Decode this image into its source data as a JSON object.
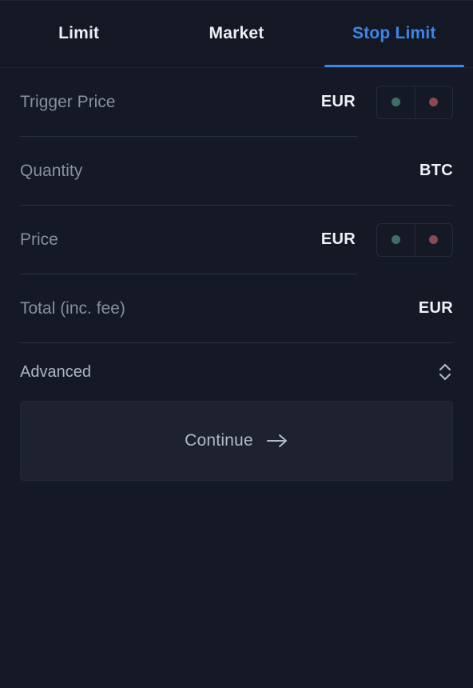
{
  "tabs": [
    {
      "label": "Limit",
      "active": false
    },
    {
      "label": "Market",
      "active": false
    },
    {
      "label": "Stop Limit",
      "active": true
    }
  ],
  "fields": {
    "trigger_price": {
      "placeholder": "Trigger Price",
      "value": "",
      "unit": "EUR",
      "has_side_toggle": true
    },
    "quantity": {
      "placeholder": "Quantity",
      "value": "",
      "unit": "BTC",
      "has_side_toggle": false
    },
    "price": {
      "placeholder": "Price",
      "value": "",
      "unit": "EUR",
      "has_side_toggle": true
    },
    "total": {
      "placeholder": "Total (inc. fee)",
      "value": "",
      "unit": "EUR",
      "has_side_toggle": false
    }
  },
  "side_toggle": {
    "buy_icon": "green-dot-icon",
    "sell_icon": "red-dot-icon"
  },
  "advanced": {
    "label": "Advanced",
    "icon": "chevron-up-down-icon"
  },
  "continue": {
    "label": "Continue",
    "icon": "arrow-right-icon"
  },
  "colors": {
    "background": "#151926",
    "tabbar_background": "#141825",
    "accent": "#3d85e8",
    "text_primary": "#eceff5",
    "text_muted": "#888f9e",
    "divider": "#2b3040",
    "buy_dot": "#3e6f66",
    "sell_dot": "#8a4a4f",
    "button_background": "#1d2130"
  }
}
